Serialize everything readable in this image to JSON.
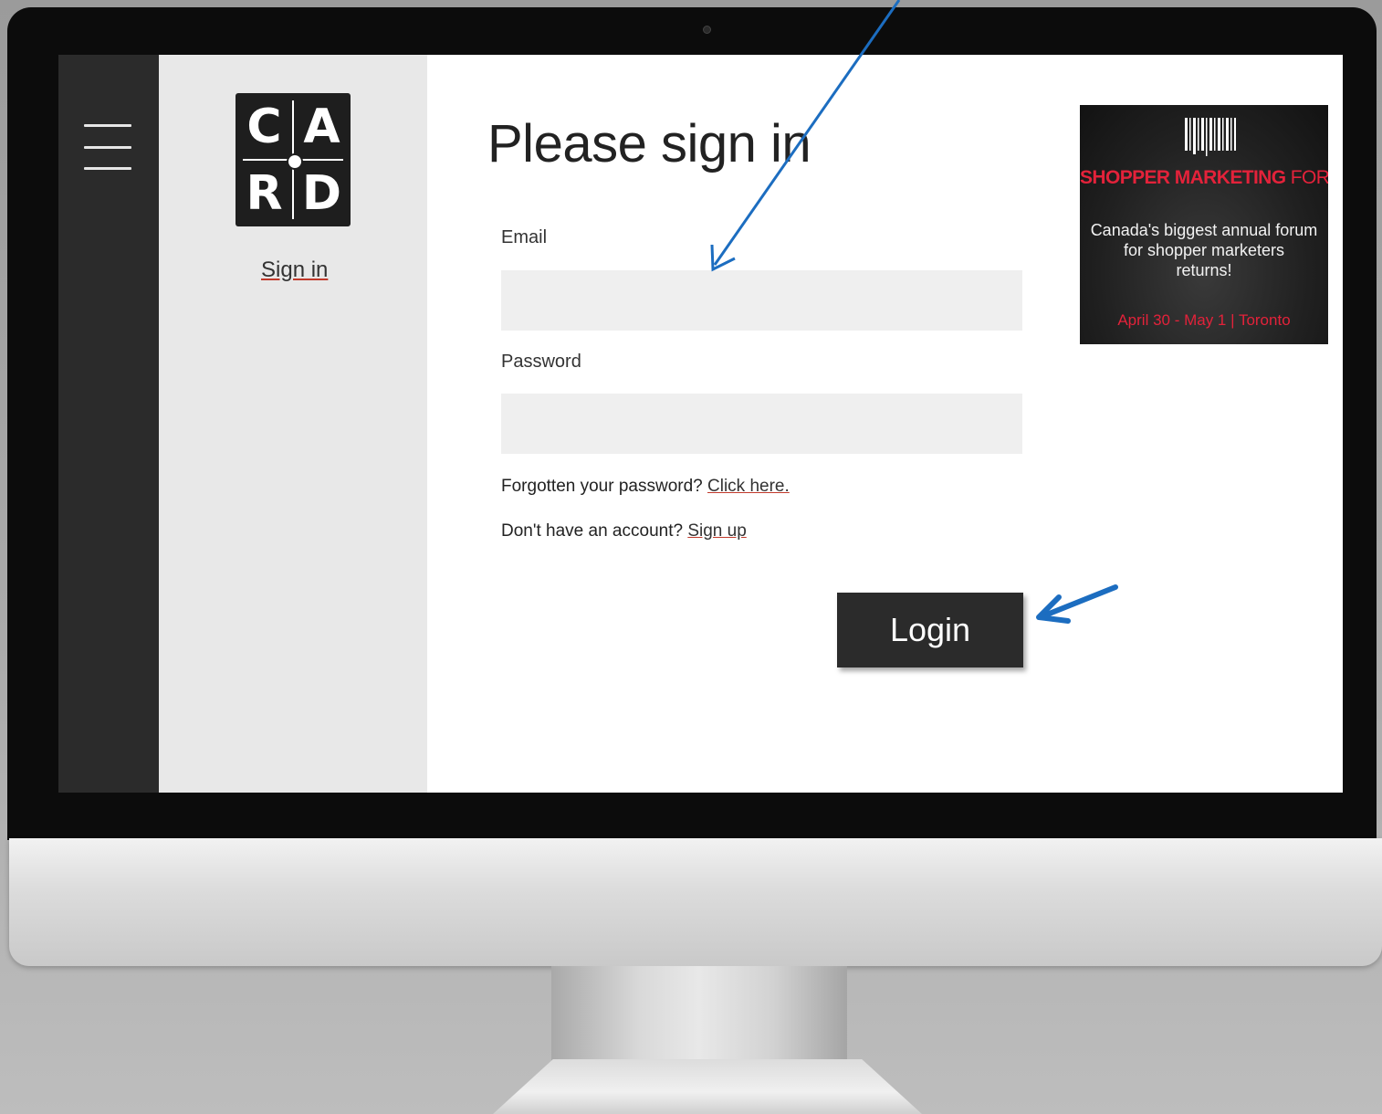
{
  "sidebar": {
    "menu_icon": "hamburger-menu-icon",
    "logo_letters": [
      "C",
      "A",
      "R",
      "D"
    ],
    "signin_link": "Sign in"
  },
  "main": {
    "title": "Please sign in",
    "email": {
      "label": "Email",
      "value": "",
      "placeholder": ""
    },
    "password": {
      "label": "Password",
      "value": "",
      "placeholder": ""
    },
    "forgot_text": "Forgotten your password?",
    "forgot_link": "Click here.",
    "signup_text": "Don't have an account?",
    "signup_link": "Sign up",
    "login_button": "Login"
  },
  "ad": {
    "icon": "barcode-icon",
    "headline_bold": "SHOPPER MARKETING",
    "headline_light": "FORUM",
    "body_lines": [
      "Canada's biggest annual forum",
      "for shopper marketers",
      "returns!"
    ],
    "date": "April 30 - May 1 | Toronto"
  },
  "colors": {
    "accent_red": "#e3223a",
    "rail": "#2b2b2b",
    "side_panel": "#e8e8e8",
    "field_bg": "#efefef",
    "annotation_arrow": "#1c6dc0"
  }
}
